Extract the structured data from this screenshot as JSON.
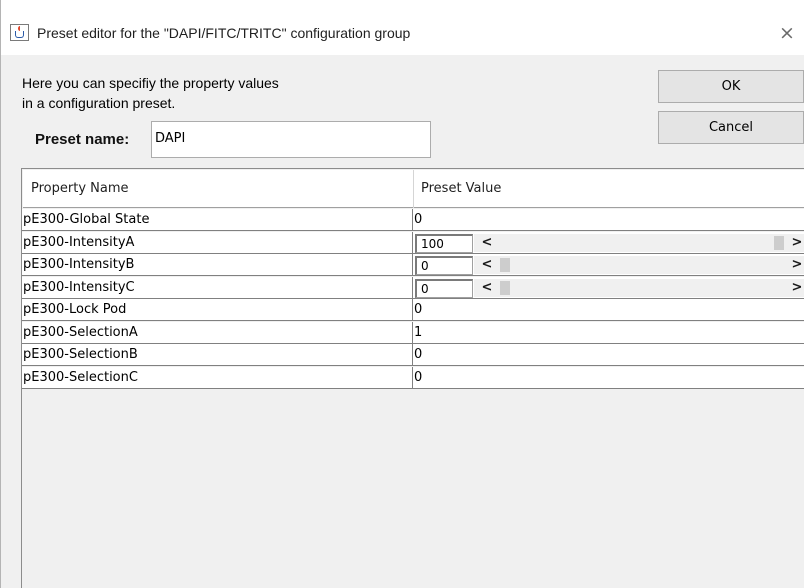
{
  "window": {
    "title": "Preset editor for the \"DAPI/FITC/TRITC\" configuration group",
    "close_glyph": "×",
    "icon": "java-cup-icon"
  },
  "help": {
    "line1": "Here you can specifiy the property values",
    "line2": "in a configuration preset."
  },
  "preset": {
    "label": "Preset name:",
    "value": "DAPI"
  },
  "buttons": {
    "ok": "OK",
    "cancel": "Cancel"
  },
  "table": {
    "headers": {
      "name": "Property Name",
      "value": "Preset Value"
    },
    "rows": [
      {
        "name": "pE300-Global State",
        "value": "0",
        "slider": false
      },
      {
        "name": "pE300-IntensityA",
        "value": "100",
        "slider": true,
        "level": 1.0
      },
      {
        "name": "pE300-IntensityB",
        "value": "0",
        "slider": true,
        "level": 0.0
      },
      {
        "name": "pE300-IntensityC",
        "value": "0",
        "slider": true,
        "level": 0.0
      },
      {
        "name": "pE300-Lock Pod",
        "value": "0",
        "slider": false
      },
      {
        "name": "pE300-SelectionA",
        "value": "1",
        "slider": false
      },
      {
        "name": "pE300-SelectionB",
        "value": "0",
        "slider": false
      },
      {
        "name": "pE300-SelectionC",
        "value": "0",
        "slider": false
      }
    ]
  },
  "scrollbar": {
    "left_glyph": "<",
    "right_glyph": ">"
  },
  "colors": {
    "dialog_bg": "#f0f0f0",
    "button_bg": "#e4e4e4",
    "grid_line": "#808080"
  }
}
